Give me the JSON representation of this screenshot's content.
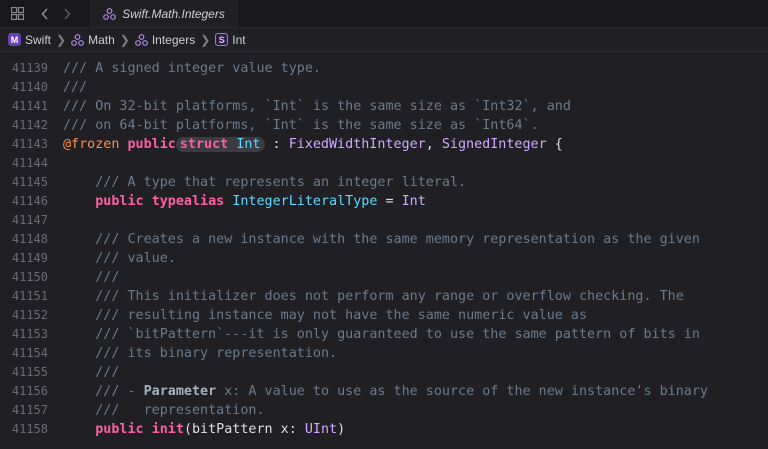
{
  "tab": {
    "title": "Swift.Math.Integers"
  },
  "jumpbar": [
    {
      "badge": "M",
      "label": "Swift"
    },
    {
      "badge": "pkg",
      "label": "Math"
    },
    {
      "badge": "pkg",
      "label": "Integers"
    },
    {
      "badge": "S",
      "label": "Int"
    }
  ],
  "lines": {
    "l41139": {
      "num": "41139",
      "text": "/// A signed integer value type."
    },
    "l41140": {
      "num": "41140",
      "text": "///"
    },
    "l41141": {
      "num": "41141",
      "text": "/// On 32-bit platforms, `Int` is the same size as `Int32`, and"
    },
    "l41142": {
      "num": "41142",
      "text": "/// on 64-bit platforms, `Int` is the same size as `Int64`."
    },
    "l41143": {
      "num": "41143",
      "attr": "@frozen",
      "public": "public",
      "struct": "struct",
      "name": "Int",
      "colon": " :",
      "p1": "FixedWidthInteger",
      "comma": ",",
      "p2": "SignedInteger",
      "brace": " {"
    },
    "l41144": {
      "num": "41144"
    },
    "l41145": {
      "num": "41145",
      "text": "/// A type that represents an integer literal."
    },
    "l41146": {
      "num": "41146",
      "public": "public",
      "kw": "typealias",
      "name": "IntegerLiteralType",
      "eq": " =",
      "type": "Int"
    },
    "l41147": {
      "num": "41147"
    },
    "l41148": {
      "num": "41148",
      "text": "/// Creates a new instance with the same memory representation as the given"
    },
    "l41149": {
      "num": "41149",
      "text": "/// value."
    },
    "l41150": {
      "num": "41150",
      "text": "///"
    },
    "l41151": {
      "num": "41151",
      "text": "/// This initializer does not perform any range or overflow checking. The"
    },
    "l41152": {
      "num": "41152",
      "text": "/// resulting instance may not have the same numeric value as"
    },
    "l41153": {
      "num": "41153",
      "text": "/// `bitPattern`---it is only guaranteed to use the same pattern of bits in"
    },
    "l41154": {
      "num": "41154",
      "text": "/// its binary representation."
    },
    "l41155": {
      "num": "41155",
      "text": "///"
    },
    "l41156": {
      "num": "41156",
      "pre": "/// - ",
      "param": "Parameter",
      "rest": " x: A value to use as the source of the new instance's binary"
    },
    "l41157": {
      "num": "41157",
      "text": "///   representation."
    },
    "l41158": {
      "num": "41158",
      "public": "public",
      "init": "init",
      "args": "(bitPattern x: ",
      "type": "UInt",
      "close": ")"
    }
  }
}
